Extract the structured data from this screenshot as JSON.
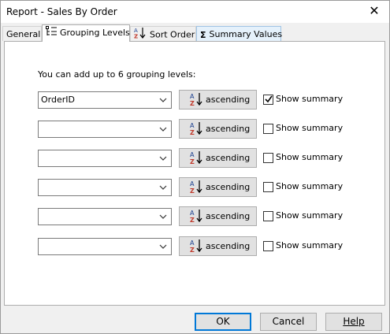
{
  "window": {
    "title": "Report - Sales By Order",
    "close_glyph": "✕"
  },
  "tabs": [
    {
      "label": "General",
      "icon": null
    },
    {
      "label": "Grouping Levels",
      "icon": "grouping-levels-icon"
    },
    {
      "label": "Sort Order",
      "icon": "sort-az-icon"
    },
    {
      "label": "Summary Values",
      "icon": "sigma-icon",
      "icon_glyph": "Σ"
    }
  ],
  "grouping": {
    "intro": "You can add up to 6 grouping levels:",
    "levels": [
      {
        "field": "OrderID",
        "sort": "ascending",
        "show_summary": true,
        "summary_label": "Show summary"
      },
      {
        "field": "",
        "sort": "ascending",
        "show_summary": false,
        "summary_label": "Show summary"
      },
      {
        "field": "",
        "sort": "ascending",
        "show_summary": false,
        "summary_label": "Show summary"
      },
      {
        "field": "",
        "sort": "ascending",
        "show_summary": false,
        "summary_label": "Show summary"
      },
      {
        "field": "",
        "sort": "ascending",
        "show_summary": false,
        "summary_label": "Show summary"
      },
      {
        "field": "",
        "sort": "ascending",
        "show_summary": false,
        "summary_label": "Show summary"
      }
    ]
  },
  "buttons": {
    "ok": "OK",
    "cancel": "Cancel",
    "help": "Help"
  },
  "colors": {
    "sort_icon_a": "#1a3f8f",
    "sort_icon_z": "#c0392b",
    "default_button_border": "#0078d7"
  }
}
